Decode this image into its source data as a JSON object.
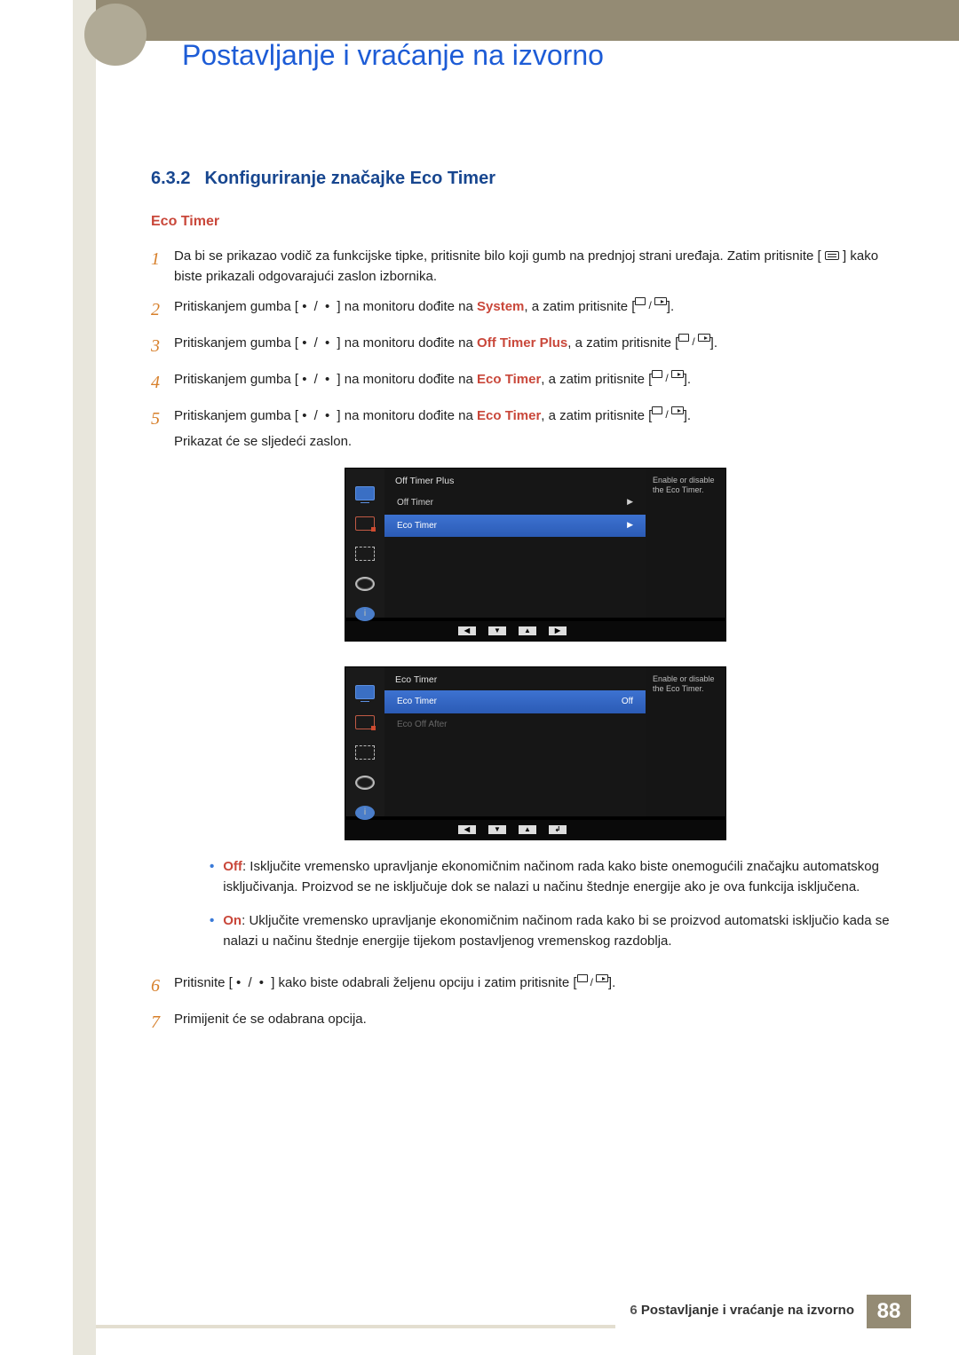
{
  "chapter": {
    "title": "Postavljanje i vraćanje na izvorno"
  },
  "section": {
    "number": "6.3.2",
    "title": "Konfiguriranje značajke Eco Timer"
  },
  "subheading": "Eco Timer",
  "steps": {
    "s1": "Da bi se prikazao vodič za funkcijske tipke, pritisnite bilo koji gumb na prednjoj strani uređaja. Zatim pritisnite [ ",
    "s1b": " ] kako biste prikazali odgovarajući zaslon izbornika.",
    "s2a": "Pritiskanjem gumba [ ",
    "dots": " • / • ",
    "s2b": " ] na monitoru dođite na ",
    "s2c": ", a zatim pritisnite [",
    "s2end": "].",
    "kw_system": "System",
    "kw_offplus": "Off Timer Plus",
    "kw_eco": "Eco Timer",
    "s5_note": "Prikazat će se sljedeći zaslon.",
    "s6a": "Pritisnite [ ",
    "s6b": " ] kako biste odabrali željenu opciju i zatim pritisnite [",
    "s6end": "].",
    "s7": "Primijenit će se odabrana opcija."
  },
  "osd1": {
    "title": "Off Timer Plus",
    "row1": "Off Timer",
    "row2": "Eco Timer",
    "help": "Enable or disable the Eco Timer."
  },
  "osd2": {
    "title": "Eco Timer",
    "row1": "Eco Timer",
    "row1v": "Off",
    "row2": "Eco Off After",
    "help": "Enable or disable the Eco Timer."
  },
  "bullet_off_kw": "Off",
  "bullet_off": ": Isključite vremensko upravljanje ekonomičnim načinom rada kako biste onemogućili značajku automatskog isključivanja. Proizvod se ne isključuje dok se nalazi u načinu štednje energije ako je ova funkcija isključena.",
  "bullet_on_kw": "On",
  "bullet_on": ": Uključite vremensko upravljanje ekonomičnim načinom rada kako bi se proizvod automatski isključio kada se nalazi u načinu štednje energije tijekom postavljenog vremenskog razdoblja.",
  "footer": {
    "chap_no": "6",
    "chap_txt": "Postavljanje i vraćanje na izvorno",
    "page": "88"
  }
}
